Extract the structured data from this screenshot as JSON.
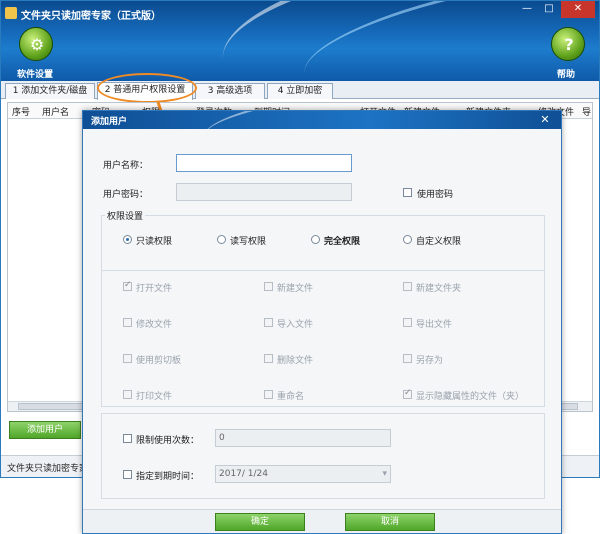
{
  "window": {
    "title": "文件夹只读加密专家（正式版）",
    "min_glyph": "—",
    "max_glyph": "□",
    "close_glyph": "✕"
  },
  "toolbar": {
    "settings_label": "软件设置",
    "help_label": "帮助",
    "help_glyph": "?",
    "settings_glyph": "⚙"
  },
  "tabs": [
    {
      "label": "1 添加文件夹/磁盘"
    },
    {
      "label": "2 普通用户权限设置"
    },
    {
      "label": "3 高级选项"
    },
    {
      "label": "4 立即加密"
    }
  ],
  "grid": {
    "columns": [
      "序号",
      "用户名",
      "密码",
      "权限",
      "登录次数",
      "到期时间",
      "打开文件",
      "新建文件",
      "新建文件夹",
      "修改文件",
      "导"
    ]
  },
  "main": {
    "add_user_button": "添加用户",
    "status_text": "文件夹只读加密专家"
  },
  "dialog": {
    "title": "添加用户",
    "close_glyph": "✕",
    "username_label": "用户名称：",
    "username_value": "",
    "password_label": "用户密码：",
    "use_password_label": "使用密码",
    "perm_group_label": "权限设置",
    "radios": [
      {
        "label": "只读权限",
        "checked": true
      },
      {
        "label": "读写权限",
        "checked": false
      },
      {
        "label": "完全权限",
        "checked": false
      },
      {
        "label": "自定义权限",
        "checked": false
      }
    ],
    "perms": [
      {
        "label": "打开文件",
        "checked": true
      },
      {
        "label": "新建文件",
        "checked": false
      },
      {
        "label": "新建文件夹",
        "checked": false
      },
      {
        "label": "修改文件",
        "checked": false
      },
      {
        "label": "导入文件",
        "checked": false
      },
      {
        "label": "导出文件",
        "checked": false
      },
      {
        "label": "使用剪切板",
        "checked": false
      },
      {
        "label": "删除文件",
        "checked": false
      },
      {
        "label": "另存为",
        "checked": false
      },
      {
        "label": "打印文件",
        "checked": false
      },
      {
        "label": "重命名",
        "checked": false
      },
      {
        "label": "显示隐藏属性的文件（夹）",
        "checked": true
      }
    ],
    "limit_uses_label": "限制使用次数：",
    "limit_uses_value": "0",
    "expiry_label": "指定到期时间：",
    "expiry_value": "2017/ 1/24",
    "ok_button": "确定",
    "cancel_button": "取消"
  },
  "colors": {
    "accent_green": "#4fa629",
    "title_blue": "#1466b5",
    "highlight_orange": "#f08a24"
  }
}
